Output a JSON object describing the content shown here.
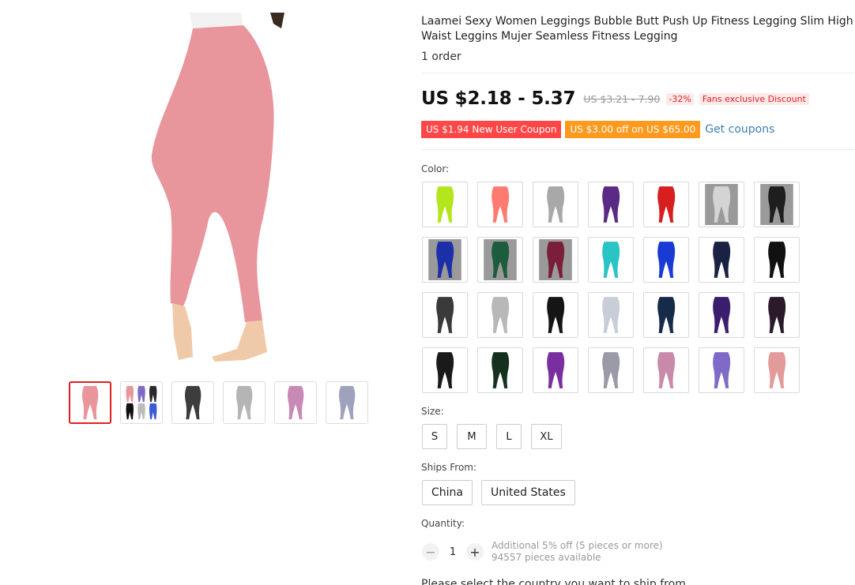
{
  "product": {
    "title": "Laamei Sexy Women Leggings Bubble Butt Push Up Fitness Legging Slim High Waist Leggins Mujer Seamless Fitness Legging",
    "orders": "1 order"
  },
  "price": {
    "current": "US $2.18 - 5.37",
    "original": "US $3.21 - 7.90",
    "discount": "-32%",
    "fans_tag": "Fans exclusive Discount"
  },
  "coupons": {
    "new_user": "US $1.94 New User Coupon",
    "store": "US $3.00 off on US $65.00",
    "get_link": "Get coupons"
  },
  "color": {
    "label": "Color:",
    "swatches": [
      {
        "icon": "legging-icon",
        "color": "#b5e61d",
        "bg": "#ffffff"
      },
      {
        "icon": "legging-icon",
        "color": "#ff7b72",
        "bg": "#ffffff"
      },
      {
        "icon": "legging-icon",
        "color": "#a8a8a8",
        "bg": "#ffffff"
      },
      {
        "icon": "legging-icon",
        "color": "#5b2a86",
        "bg": "#ffffff"
      },
      {
        "icon": "legging-icon",
        "color": "#d81e1e",
        "bg": "#ffffff"
      },
      {
        "icon": "legging-icon",
        "color": "#d4d4d4",
        "bg": "#9a9a9a"
      },
      {
        "icon": "legging-icon",
        "color": "#1e1e1e",
        "bg": "#9a9a9a"
      },
      {
        "icon": "legging-icon",
        "color": "#1c2fa8",
        "bg": "#9a9a9a"
      },
      {
        "icon": "legging-icon",
        "color": "#1d5c3c",
        "bg": "#9a9a9a"
      },
      {
        "icon": "legging-icon",
        "color": "#7a1e3a",
        "bg": "#9a9a9a"
      },
      {
        "icon": "legging-icon",
        "color": "#2bc4c4",
        "bg": "#ffffff"
      },
      {
        "icon": "legging-icon",
        "color": "#1a3ad6",
        "bg": "#ffffff"
      },
      {
        "icon": "legging-icon",
        "color": "#1a2244",
        "bg": "#ffffff"
      },
      {
        "icon": "legging-icon",
        "color": "#111111",
        "bg": "#ffffff"
      },
      {
        "icon": "legging-icon",
        "color": "#3a3a3a",
        "bg": "#ffffff"
      },
      {
        "icon": "legging-icon",
        "color": "#b8b8b8",
        "bg": "#ffffff"
      },
      {
        "icon": "legging-icon",
        "color": "#151515",
        "bg": "#ffffff"
      },
      {
        "icon": "legging-icon",
        "color": "#c9cdd8",
        "bg": "#ffffff"
      },
      {
        "icon": "legging-icon",
        "color": "#162a4a",
        "bg": "#ffffff"
      },
      {
        "icon": "legging-icon",
        "color": "#3b1d6e",
        "bg": "#ffffff"
      },
      {
        "icon": "legging-icon",
        "color": "#2a1a2a",
        "bg": "#ffffff"
      },
      {
        "icon": "legging-icon",
        "color": "#1a1a1a",
        "bg": "#ffffff"
      },
      {
        "icon": "legging-icon",
        "color": "#15301f",
        "bg": "#ffffff"
      },
      {
        "icon": "legging-icon",
        "color": "#7a2fa0",
        "bg": "#ffffff"
      },
      {
        "icon": "legging-icon",
        "color": "#9a9aa8",
        "bg": "#ffffff"
      },
      {
        "icon": "legging-icon",
        "color": "#c98aaa",
        "bg": "#ffffff"
      },
      {
        "icon": "legging-icon",
        "color": "#7f6ac8",
        "bg": "#ffffff"
      },
      {
        "icon": "legging-icon",
        "color": "#e39a9a",
        "bg": "#ffffff"
      }
    ]
  },
  "size": {
    "label": "Size:",
    "options": [
      "S",
      "M",
      "L",
      "XL"
    ]
  },
  "ships_from": {
    "label": "Ships From:",
    "options": [
      "China",
      "United States"
    ]
  },
  "quantity": {
    "label": "Quantity:",
    "value": "1",
    "minus_icon": "minus-icon",
    "plus_icon": "plus-icon",
    "discount_note": "Additional 5% off (5 pieces or more)",
    "available": "94557 pieces available"
  },
  "ship_note": "Please select the country you want to ship from",
  "gallery": {
    "main_color": "#e8959c",
    "thumbs": [
      {
        "icon": "legging-icon",
        "color": "#e8959c"
      },
      {
        "icon": "multi-legging-icon",
        "color": "#e8959c"
      },
      {
        "icon": "legging-icon",
        "color": "#3d3d3d"
      },
      {
        "icon": "legging-icon",
        "color": "#b5b5b5"
      },
      {
        "icon": "legging-icon",
        "color": "#c78ab5"
      },
      {
        "icon": "legging-icon",
        "color": "#9fa2bd"
      }
    ]
  }
}
